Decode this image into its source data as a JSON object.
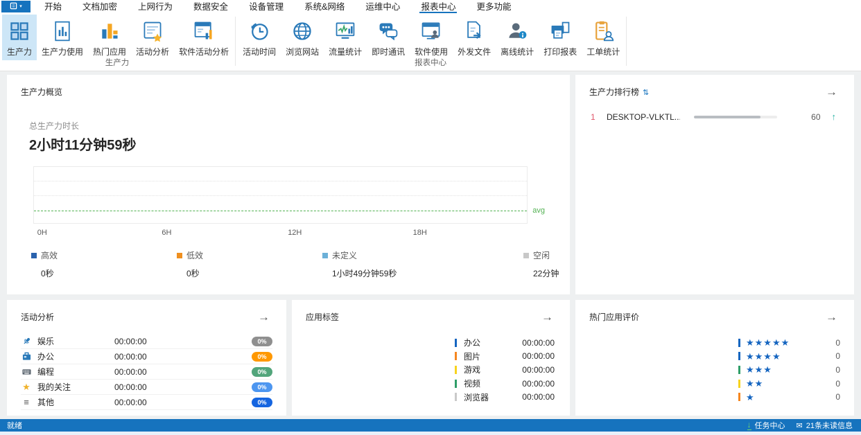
{
  "icons": {
    "sort": "⇅",
    "arrow_right": "→",
    "trend_up": "↑",
    "download": "↓",
    "envelope": "✉",
    "caret": "▾",
    "star": "★",
    "lines": "≡"
  },
  "menu": {
    "items": [
      {
        "label": "开始",
        "selected": false
      },
      {
        "label": "文档加密",
        "selected": false
      },
      {
        "label": "上网行为",
        "selected": false
      },
      {
        "label": "数据安全",
        "selected": false
      },
      {
        "label": "设备管理",
        "selected": false
      },
      {
        "label": "系统&网络",
        "selected": false
      },
      {
        "label": "运维中心",
        "selected": false
      },
      {
        "label": "报表中心",
        "selected": true
      },
      {
        "label": "更多功能",
        "selected": false
      }
    ]
  },
  "ribbon": {
    "groups": [
      {
        "label": "生产力",
        "items": [
          {
            "label": "生产力",
            "icon": "grid-icon",
            "selected": true
          },
          {
            "label": "生产力使用",
            "icon": "doc-chart-icon",
            "selected": false
          },
          {
            "label": "热门应用",
            "icon": "bar-chart-icon",
            "selected": false
          },
          {
            "label": "活动分析",
            "icon": "doc-star-icon",
            "selected": false
          },
          {
            "label": "软件活动分析",
            "icon": "window-chart-icon",
            "selected": false
          }
        ]
      },
      {
        "label": "报表中心",
        "items": [
          {
            "label": "活动时间",
            "icon": "clock-history-icon",
            "selected": false
          },
          {
            "label": "浏览网站",
            "icon": "globe-icon",
            "selected": false
          },
          {
            "label": "流量统计",
            "icon": "traffic-chart-icon",
            "selected": false
          },
          {
            "label": "即时通讯",
            "icon": "chat-bubbles-icon",
            "selected": false
          },
          {
            "label": "软件使用",
            "icon": "window-user-icon",
            "selected": false
          },
          {
            "label": "外发文件",
            "icon": "doc-arrow-icon",
            "selected": false
          },
          {
            "label": "离线统计",
            "icon": "user-info-icon",
            "selected": false
          },
          {
            "label": "打印报表",
            "icon": "printer-icon",
            "selected": false
          },
          {
            "label": "工单统计",
            "icon": "clipboard-user-icon",
            "selected": false
          }
        ]
      }
    ]
  },
  "overview": {
    "title": "生产力概览",
    "total_label": "总生产力时长",
    "total_value": "2小时11分钟59秒",
    "avg_label": "avg",
    "x_ticks": [
      "0H",
      "6H",
      "12H",
      "18H"
    ],
    "legend": [
      {
        "label": "高效",
        "value": "0秒",
        "color": "#2a62ad"
      },
      {
        "label": "低效",
        "value": "0秒",
        "color": "#ef8f1f"
      },
      {
        "label": "未定义",
        "value": "1小时49分钟59秒",
        "color": "#6cb0d8"
      },
      {
        "label": "空闲",
        "value": "22分钟",
        "color": "#c8c8c8"
      }
    ],
    "chart_data": {
      "type": "area",
      "title": "生产力概览",
      "xlabel": "",
      "ylabel": "",
      "x_ticks": [
        "0H",
        "6H",
        "12H",
        "18H"
      ],
      "x_range_hours": [
        0,
        24
      ],
      "grid": true,
      "legend_position": "bottom",
      "series": [
        {
          "name": "高效",
          "color": "#2a62ad",
          "total": "0秒",
          "values": []
        },
        {
          "name": "低效",
          "color": "#ef8f1f",
          "total": "0秒",
          "values": []
        },
        {
          "name": "未定义",
          "color": "#6cb0d8",
          "total": "1小时49分钟59秒",
          "values": []
        },
        {
          "name": "空闲",
          "color": "#c8c8c8",
          "total": "22分钟",
          "values": []
        }
      ],
      "annotations": [
        {
          "type": "avg-line",
          "label": "avg",
          "color": "#52b152",
          "y_fraction": 0.78
        }
      ],
      "plot_empty": true
    }
  },
  "ranking": {
    "title": "生产力排行榜",
    "rows": [
      {
        "rank": "1",
        "name": "DESKTOP-VLKTL...",
        "score": "60",
        "progress_width": "80%",
        "trend": "up"
      }
    ]
  },
  "activity": {
    "title": "活动分析",
    "rows": [
      {
        "icon": "microphone-icon",
        "label": "娱乐",
        "time": "00:00:00",
        "percent": "0%",
        "badge_color": "#8f8f8f"
      },
      {
        "icon": "briefcase-icon",
        "label": "办公",
        "time": "00:00:00",
        "percent": "0%",
        "badge_color": "#ff9800"
      },
      {
        "icon": "keyboard-icon",
        "label": "编程",
        "time": "00:00:00",
        "percent": "0%",
        "badge_color": "#52a57b"
      },
      {
        "icon": "star-icon",
        "label": "我的关注",
        "time": "00:00:00",
        "percent": "0%",
        "badge_color": "#4d96f0"
      },
      {
        "icon": "menu-lines-icon",
        "label": "其他",
        "time": "00:00:00",
        "percent": "0%",
        "badge_color": "#1565e0"
      }
    ]
  },
  "app_tags": {
    "title": "应用标签",
    "rows": [
      {
        "label": "办公",
        "time": "00:00:00",
        "color": "#1565c0"
      },
      {
        "label": "图片",
        "time": "00:00:00",
        "color": "#f5861f"
      },
      {
        "label": "游戏",
        "time": "00:00:00",
        "color": "#f7d31e"
      },
      {
        "label": "视频",
        "time": "00:00:00",
        "color": "#2f9e68"
      },
      {
        "label": "浏览器",
        "time": "00:00:00",
        "color": "#c9c9c9"
      }
    ]
  },
  "app_ratings": {
    "title": "热门应用评价",
    "star_color": "#1565c0",
    "rows": [
      {
        "stars": 5,
        "stars_text": "★★★★★",
        "count": "0",
        "bar_color": "#1565c0"
      },
      {
        "stars": 4,
        "stars_text": "★★★★",
        "count": "0",
        "bar_color": "#1565c0"
      },
      {
        "stars": 3,
        "stars_text": "★★★",
        "count": "0",
        "bar_color": "#2f9e68"
      },
      {
        "stars": 2,
        "stars_text": "★★",
        "count": "0",
        "bar_color": "#f7d31e"
      },
      {
        "stars": 1,
        "stars_text": "★",
        "count": "0",
        "bar_color": "#f5861f"
      }
    ]
  },
  "statusbar": {
    "ready": "就绪",
    "task_center": "任务中心",
    "unread": "21条未读信息"
  }
}
